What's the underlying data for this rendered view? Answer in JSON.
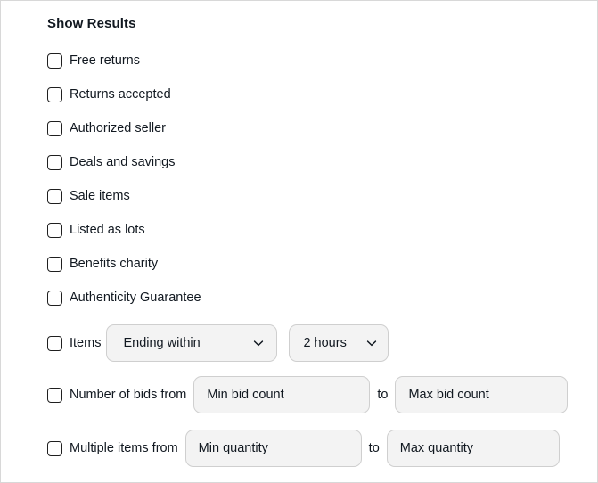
{
  "panel": {
    "title": "Show Results"
  },
  "checkbox_options": [
    {
      "label": "Free returns"
    },
    {
      "label": "Returns accepted"
    },
    {
      "label": "Authorized seller"
    },
    {
      "label": "Deals and savings"
    },
    {
      "label": "Sale items"
    },
    {
      "label": "Listed as lots"
    },
    {
      "label": "Benefits charity"
    },
    {
      "label": "Authenticity Guarantee"
    }
  ],
  "items_row": {
    "label": "Items",
    "condition_select": {
      "value": "Ending within",
      "icon": "chevron-down-icon"
    },
    "duration_select": {
      "value": "2 hours",
      "icon": "chevron-down-icon"
    }
  },
  "bids_row": {
    "label": "Number of bids from",
    "min_placeholder": "Min bid count",
    "min_value": "",
    "separator": "to",
    "max_placeholder": "Max bid count",
    "max_value": ""
  },
  "quantity_row": {
    "label": "Multiple items from",
    "min_placeholder": "Min quantity",
    "min_value": "",
    "separator": "to",
    "max_placeholder": "Max quantity",
    "max_value": ""
  },
  "colors": {
    "text": "#111820",
    "field_background": "#f3f3f3",
    "field_border": "#cfcfcf",
    "checkbox_border": "#1f1f1f",
    "panel_border": "#d8d8d8"
  }
}
